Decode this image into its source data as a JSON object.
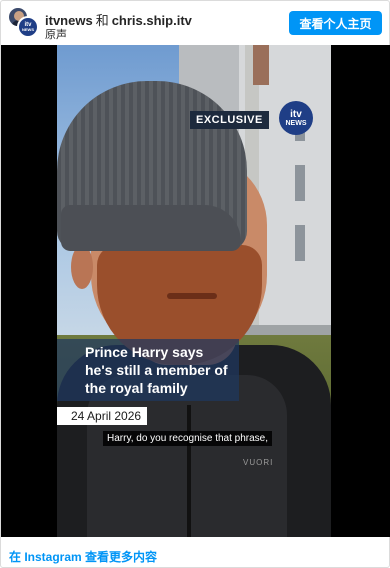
{
  "header": {
    "primary_account": "itvnews",
    "conjunction": "和",
    "secondary_account": "chris.ship.itv",
    "audio_label": "原声",
    "profile_button_label": "查看个人主页",
    "avatar_icons": [
      "person-avatar-icon",
      "itv-news-avatar-icon"
    ],
    "avatar_itv_text": "itv",
    "avatar_news_text": "NEWS"
  },
  "video": {
    "exclusive_label": "EXCLUSIVE",
    "logo_itv_text": "itv",
    "logo_news_text": "NEWS",
    "headline": "Prince Harry says he's still a member of the royal family",
    "date": "24 April 2026",
    "subtitle": "Harry, do you recognise that phrase,",
    "jacket_brand": "VUORI"
  },
  "footer": {
    "link_label": "在 Instagram 查看更多内容"
  },
  "colors": {
    "accent": "#0095f6",
    "itv_blue": "#1f3e86",
    "headline_overlay": "#1e385f",
    "text": "#262626"
  }
}
